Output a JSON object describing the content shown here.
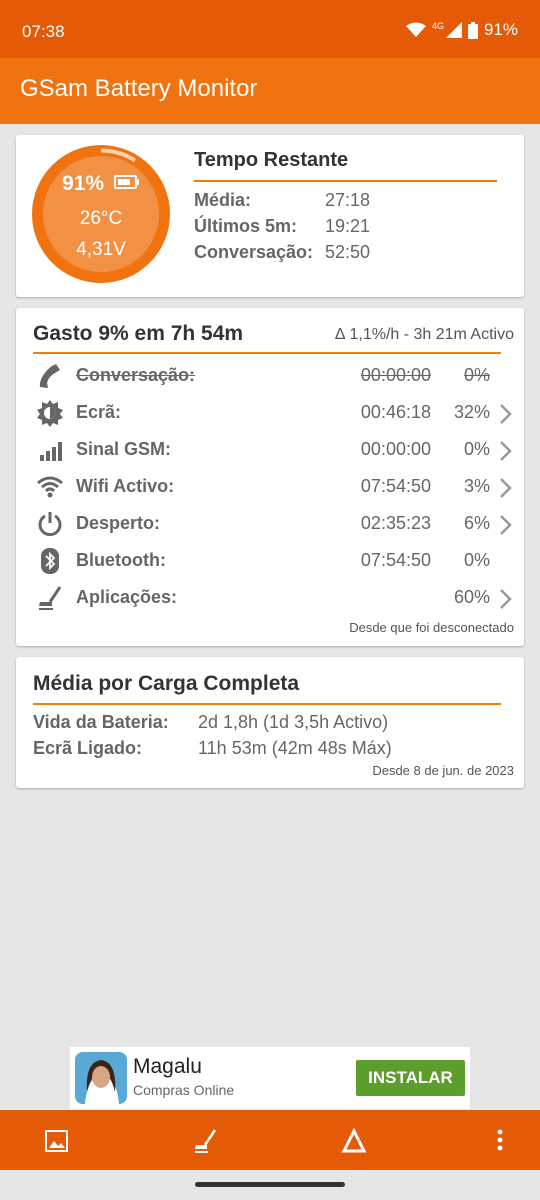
{
  "status": {
    "time": "07:38",
    "network": "4G",
    "battery": "91%"
  },
  "app": {
    "title": "GSam Battery Monitor"
  },
  "gauge": {
    "percent": "91%",
    "temperature": "26°C",
    "voltage": "4,31V",
    "level": 0.91
  },
  "remaining": {
    "title": "Tempo Restante",
    "rows": [
      {
        "label": "Média:",
        "value": "27:18"
      },
      {
        "label": "Últimos 5m:",
        "value": "19:21"
      },
      {
        "label": "Conversação:",
        "value": "52:50"
      }
    ]
  },
  "usage": {
    "title": "Gasto 9% em 7h 54m",
    "rate": "∆ 1,1%/h - 3h 21m Activo",
    "rows": [
      {
        "label": "Conversação:",
        "time": "00:00:00",
        "pct": "0%",
        "icon": "phone-icon"
      },
      {
        "label": "Ecrã:",
        "time": "00:46:18",
        "pct": "32%",
        "icon": "brightness-icon"
      },
      {
        "label": "Sinal GSM:",
        "time": "00:00:00",
        "pct": "0%",
        "icon": "signal-bars-icon"
      },
      {
        "label": "Wifi Activo:",
        "time": "07:54:50",
        "pct": "3%",
        "icon": "wifi-icon"
      },
      {
        "label": "Desperto:",
        "time": "02:35:23",
        "pct": "6%",
        "icon": "power-icon"
      },
      {
        "label": "Bluetooth:",
        "time": "07:54:50",
        "pct": "0%",
        "icon": "bluetooth-icon"
      },
      {
        "label": "Aplicações:",
        "time": "",
        "pct": "60%",
        "icon": "apps-sweep-icon"
      }
    ],
    "footer": "Desde que foi desconectado"
  },
  "average": {
    "title": "Média por Carga Completa",
    "rows": [
      {
        "label": "Vida da Bateria:",
        "value": "2d 1,8h (1d 3,5h Activo)"
      },
      {
        "label": "Ecrã Ligado:",
        "value": "11h 53m (42m 48s Máx)"
      }
    ],
    "footer": "Desde 8 de jun. de 2023"
  },
  "ad": {
    "name": "Magalu",
    "category": "Compras Online",
    "button": "INSTALAR"
  },
  "colors": {
    "accent": "#f07310",
    "statusbar": "#e45a06",
    "install": "#5c9e2b"
  }
}
